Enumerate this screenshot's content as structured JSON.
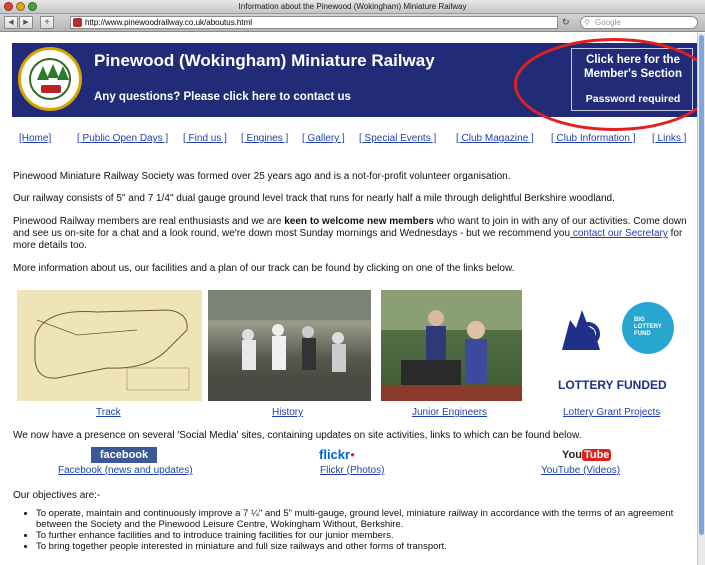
{
  "window": {
    "title": "Information about the Pinewood (Wokingham) Miniature Railway",
    "url": "http://www.pinewoodrailway.co.uk/aboutus.html",
    "search_placeholder": "Google"
  },
  "header": {
    "title": "Pinewood (Wokingham) Miniature Railway",
    "contact": "Any questions?   Please click here to contact us",
    "member_title": "Click here for the Member's Section",
    "member_password": "Password required"
  },
  "nav": [
    "[Home]",
    "[ Public Open Days ]",
    "[ Find us ]",
    "[ Engines ]",
    "[ Gallery ]",
    "[ Special Events ]",
    "[ Club Magazine ]",
    "[ Club Information ]",
    "[ Links ]"
  ],
  "paragraphs": {
    "p1": "Pinewood Miniature Railway Society was formed over 25 years ago and is a not-for-profit volunteer organisation.",
    "p2": "Our railway consists of  5\" and 7 1/4\" dual gauge ground level track that runs for nearly half a mile through delightful Berkshire woodland.",
    "p3a": "Pinewood Railway members are real enthusiasts and we are ",
    "p3b": "keen to welcome new members",
    "p3c": " who want to join in with any of our activities.   Come down and see us on-site for a chat and a look round, we're down most Sunday mornings and Wednesdays - but we recommend you",
    "p3link": " contact our Secretary",
    "p3d": " for more details too.",
    "p4": "More information about us, our facilities and a plan of our track can be found by clicking on one of the links below."
  },
  "images": [
    {
      "caption": "Track"
    },
    {
      "caption": "History"
    },
    {
      "caption": "Junior Engineers"
    },
    {
      "caption": "Lottery Grant Projects",
      "badge_text": "BIG LOTTERY FUND",
      "label": "LOTTERY FUNDED"
    }
  ],
  "social": {
    "intro": "We now have a presence on several 'Social Media' sites, containing updates on site activities, links to which can be found below.",
    "items": [
      {
        "logo": "facebook",
        "caption": "Facebook (news and updates)"
      },
      {
        "logo": "flickr",
        "caption": "Flickr (Photos)"
      },
      {
        "logo": "You",
        "logo2": "Tube",
        "caption": "YouTube (Videos)"
      }
    ]
  },
  "objectives": {
    "heading": "Our objectives are:-",
    "items": [
      "To operate, maintain and continuously improve a 7 ¼\" and 5\" multi-gauge, ground level, miniature railway in accordance with the terms of an agreement between the Society and the Pinewood Leisure Centre, Wokingham Without, Berkshire.",
      "To further enhance facilities and to introduce training facilities for our junior members.",
      "To bring together people interested in miniature and full size railways and other forms of transport."
    ]
  },
  "colors": {
    "header_bg": "#222b78",
    "link": "#1f3fb0",
    "highlight_ring": "#e0211f",
    "facebook": "#3b5998",
    "flickr_blue": "#0063dc",
    "flickr_pink": "#ff0084",
    "youtube_red": "#e02020",
    "lottery_blue": "#1f2f8a",
    "lottery_teal": "#27a6cf"
  },
  "icons": [
    "back-arrow-icon",
    "forward-arrow-icon",
    "add-bookmark-icon",
    "reload-icon",
    "search-icon",
    "favicon-icon",
    "society-logo-icon",
    "lottery-hand-icon"
  ]
}
